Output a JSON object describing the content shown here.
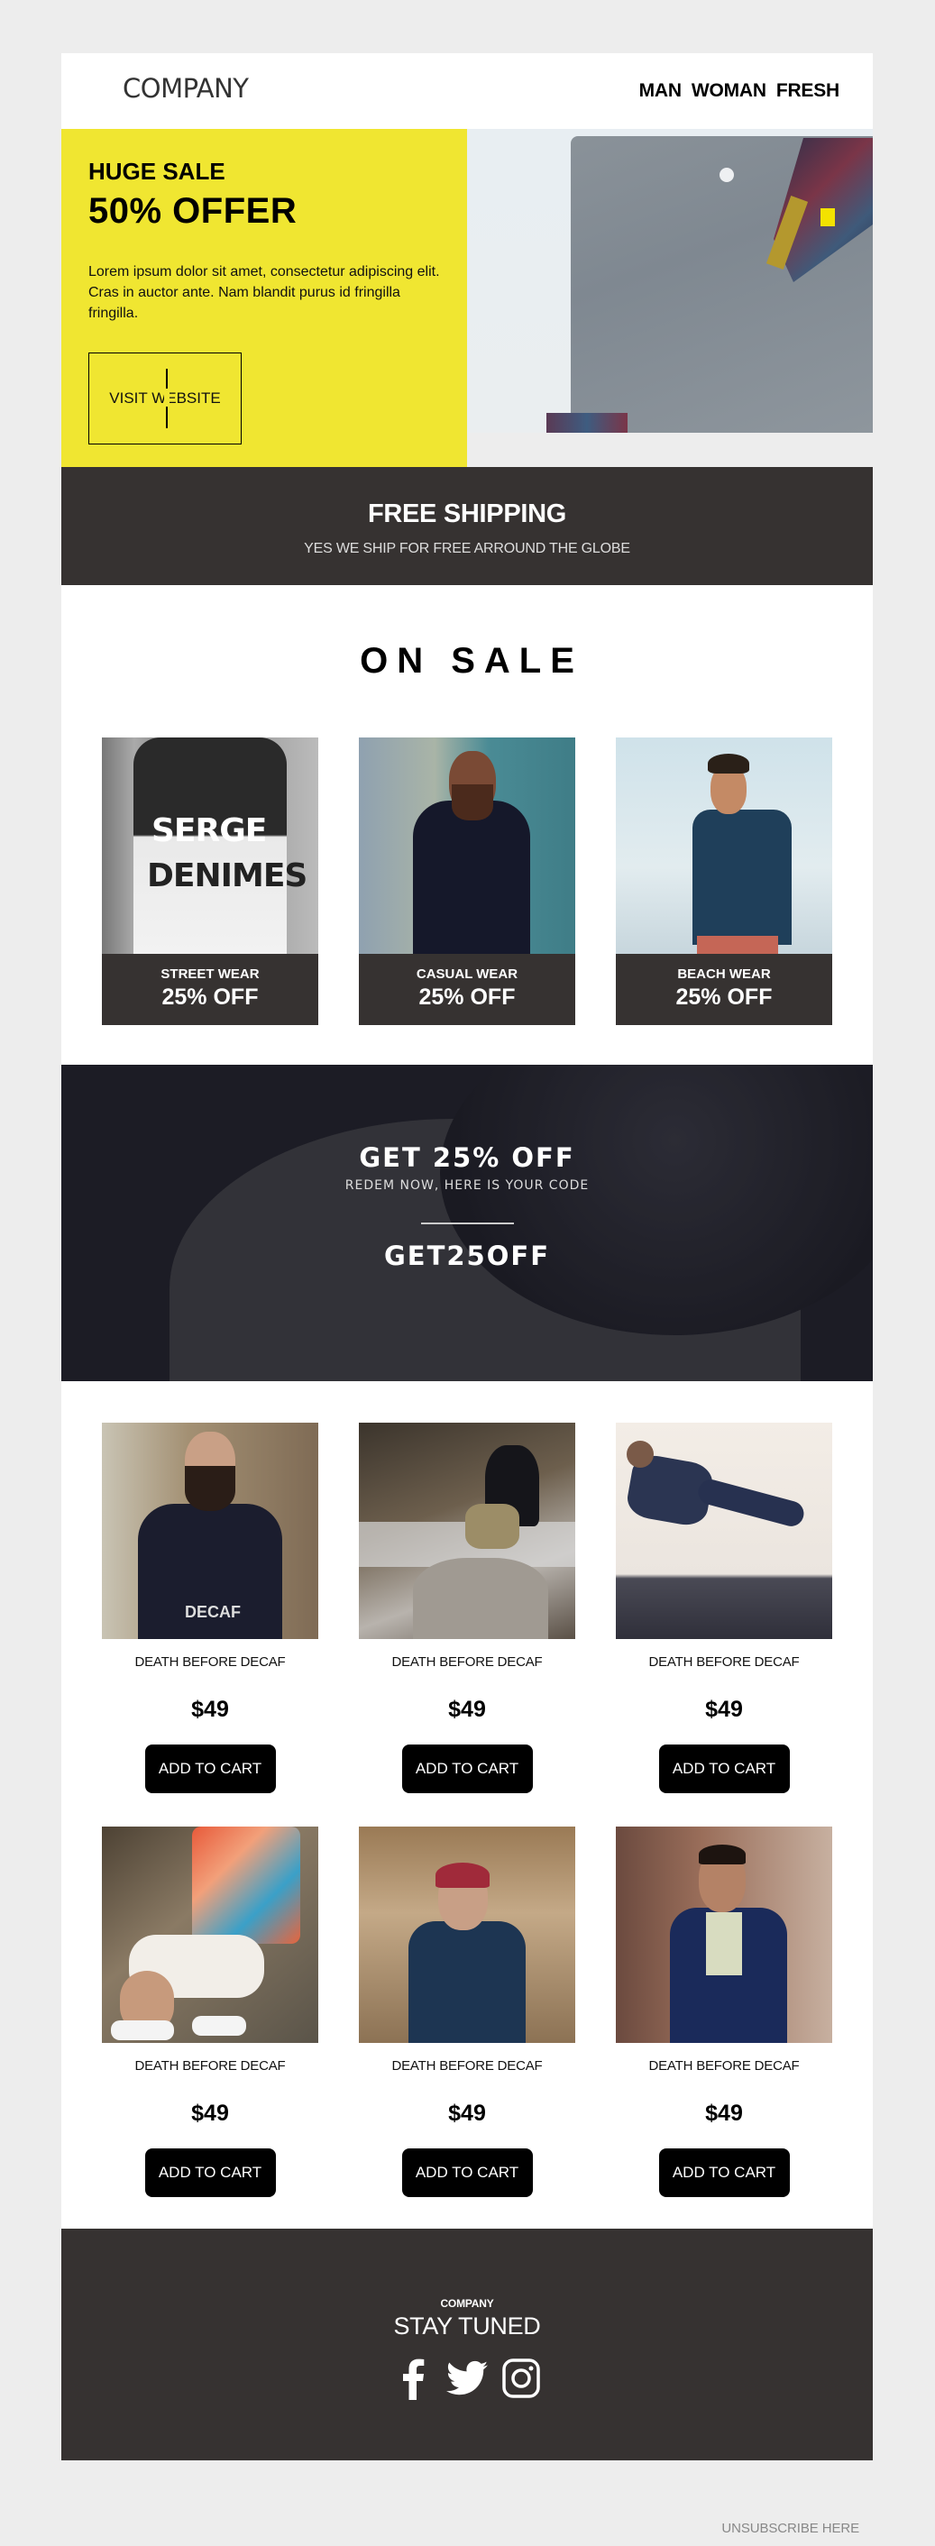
{
  "header": {
    "logo": "COMPANY",
    "nav": [
      "MAN",
      "WOMAN",
      "FRESH"
    ]
  },
  "hero": {
    "kicker": "HUGE SALE",
    "title": "50% OFFER",
    "body": "Lorem ipsum dolor sit amet, consectetur adipiscing elit. Cras in auctor ante. Nam blandit purus id fringilla fringilla.",
    "cta": "VISIT WEBSITE",
    "image": "grey-chino-shorts-photo",
    "accent": "#f0e631"
  },
  "shipping": {
    "title": "FREE SHIPPING",
    "subtitle": "YES WE SHIP FOR FREE ARROUND THE GLOBE"
  },
  "on_sale": {
    "title": "ON SALE",
    "categories": [
      {
        "name": "STREET WEAR",
        "discount": "25% OFF",
        "image": "serge-denimes-tshirt-photo"
      },
      {
        "name": "CASUAL WEAR",
        "discount": "25% OFF",
        "image": "bearded-man-sunglasses-photo"
      },
      {
        "name": "BEACH WEAR",
        "discount": "25% OFF",
        "image": "man-floral-shirt-beach-photo"
      }
    ]
  },
  "coupon": {
    "title": "GET 25% OFF",
    "subtitle": "REDEM NOW, HERE IS YOUR CODE",
    "code": "GET25OFF"
  },
  "products": [
    {
      "name": "DEATH BEFORE DECAF",
      "price": "$49",
      "button": "ADD TO CART"
    },
    {
      "name": "DEATH BEFORE DECAF",
      "price": "$49",
      "button": "ADD TO CART"
    },
    {
      "name": "DEATH BEFORE DECAF",
      "price": "$49",
      "button": "ADD TO CART"
    },
    {
      "name": "DEATH BEFORE DECAF",
      "price": "$49",
      "button": "ADD TO CART"
    },
    {
      "name": "DEATH BEFORE DECAF",
      "price": "$49",
      "button": "ADD TO CART"
    },
    {
      "name": "DEATH BEFORE DECAF",
      "price": "$49",
      "button": "ADD TO CART"
    }
  ],
  "footer": {
    "brand": "COMPANY",
    "tagline": "STAY TUNED",
    "socials": [
      "facebook-icon",
      "twitter-icon",
      "instagram-icon"
    ]
  },
  "unsubscribe": "UNSUBSCRIBE HERE",
  "colors": {
    "background": "#ededed",
    "dark": "#363231",
    "yellow": "#f0e631",
    "coupon": "#1f1f28"
  }
}
